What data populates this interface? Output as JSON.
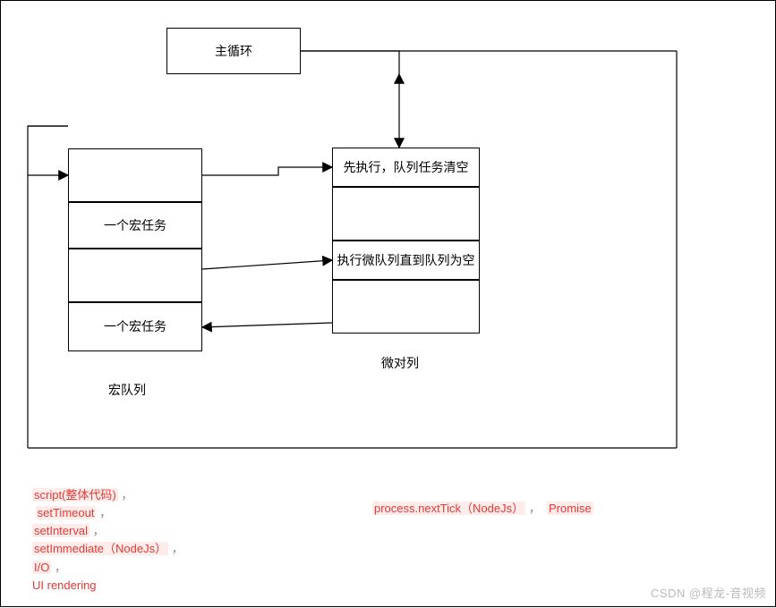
{
  "mainLoop": {
    "label": "主循环"
  },
  "macroQueue": {
    "label": "宏队列",
    "items": [
      "一个宏任务",
      "一个宏任务"
    ]
  },
  "microQueue": {
    "label": "微对列",
    "steps": [
      "先执行，队列任务清空",
      "执行微队列直到队列为空"
    ]
  },
  "macroExamples": {
    "script": "script(整体代码)",
    "setTimeout": "setTimeout",
    "setInterval": "setInterval",
    "setImmediate": "setImmediate（NodeJs）",
    "io": "I/O",
    "uiRendering": "UI rendering"
  },
  "microExamples": {
    "nextTick": "process.nextTick（NodeJs）",
    "promise": "Promise"
  },
  "sep": "，",
  "watermark": "CSDN @程龙-音视频"
}
